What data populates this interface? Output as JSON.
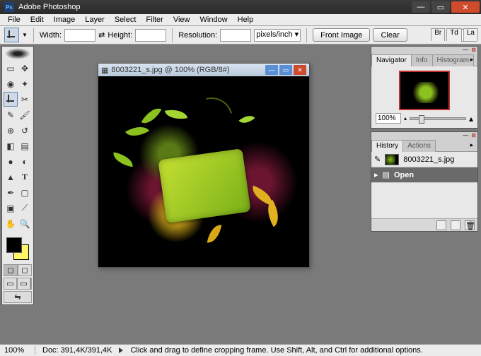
{
  "window": {
    "title": "Adobe Photoshop"
  },
  "menu": [
    "File",
    "Edit",
    "Image",
    "Layer",
    "Select",
    "Filter",
    "View",
    "Window",
    "Help"
  ],
  "options": {
    "width_label": "Width:",
    "height_label": "Height:",
    "resolution_label": "Resolution:",
    "units": "pixels/inch",
    "front_image": "Front Image",
    "clear": "Clear"
  },
  "right_tabs": [
    "Br",
    "Td",
    "La"
  ],
  "document": {
    "title": "8003221_s.jpg @ 100% (RGB/8#)"
  },
  "navigator": {
    "tabs": [
      "Navigator",
      "Info",
      "Histogram"
    ],
    "zoom": "100%"
  },
  "history": {
    "tabs": [
      "History",
      "Actions"
    ],
    "source_name": "8003221_s.jpg",
    "step": "Open"
  },
  "status": {
    "zoom": "100%",
    "doc": "Doc: 391,4K/391,4K",
    "hint": "Click and drag to define cropping frame. Use Shift, Alt, and Ctrl for additional options."
  },
  "colors": {
    "fg": "#000000",
    "bg": "#fff568"
  }
}
